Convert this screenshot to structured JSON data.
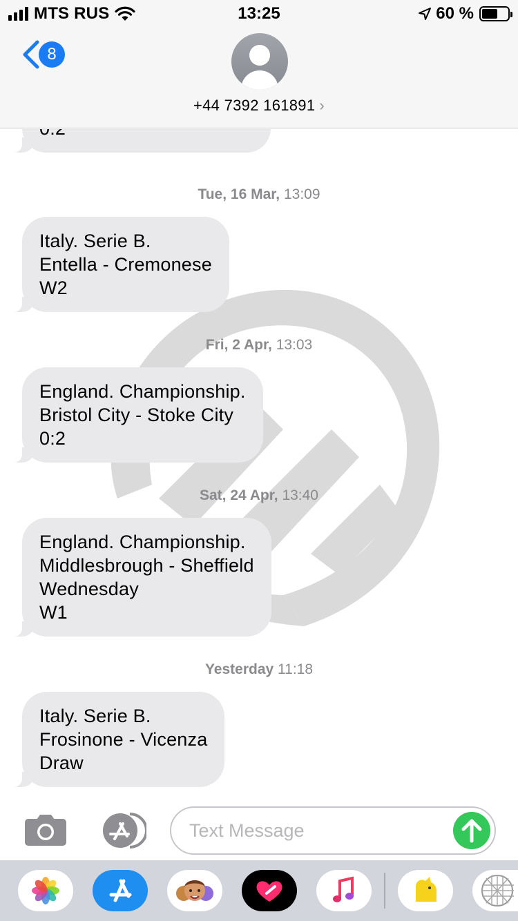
{
  "status_bar": {
    "carrier": "MTS RUS",
    "time": "13:25",
    "battery_percent": "60 %",
    "battery_level": 0.6
  },
  "header": {
    "back_badge": "8",
    "contact": "+44 7392 161891"
  },
  "conversation": {
    "partial_message": {
      "lines": [
        "0:2"
      ]
    },
    "items": [
      {
        "ts_day": "Tue, 16 Mar,",
        "ts_time": "13:09",
        "lines": [
          "Italy. Serie B.",
          "Entella - Cremonese",
          "W2"
        ]
      },
      {
        "ts_day": "Fri, 2 Apr,",
        "ts_time": "13:03",
        "lines": [
          "England. Championship.",
          "Bristol City - Stoke City",
          "0:2"
        ]
      },
      {
        "ts_day": "Sat, 24 Apr,",
        "ts_time": "13:40",
        "lines": [
          "England. Championship.",
          "Middlesbrough - Sheffield",
          "Wednesday",
          "W1"
        ]
      },
      {
        "ts_day": "Yesterday",
        "ts_time": "11:18",
        "lines": [
          "Italy. Serie B.",
          "Frosinone - Vicenza",
          "Draw"
        ]
      }
    ]
  },
  "input_bar": {
    "placeholder": "Text Message",
    "send_color": "#34c759"
  },
  "icons": {
    "back": "chevron-left-icon",
    "camera": "camera-icon",
    "apps": "app-store-icon",
    "send": "arrow-up-icon",
    "location": "location-arrow-icon",
    "wifi": "wifi-icon"
  },
  "app_drawer": [
    {
      "name": "photos-app"
    },
    {
      "name": "app-store-app"
    },
    {
      "name": "memoji-app"
    },
    {
      "name": "digital-touch-app"
    },
    {
      "name": "music-app"
    },
    {
      "name": "yellow-app"
    },
    {
      "name": "sticker-app"
    }
  ],
  "colors": {
    "accent": "#1a7cf5",
    "bubble": "#e9e9eb",
    "timestamp": "#8a8a8e"
  }
}
